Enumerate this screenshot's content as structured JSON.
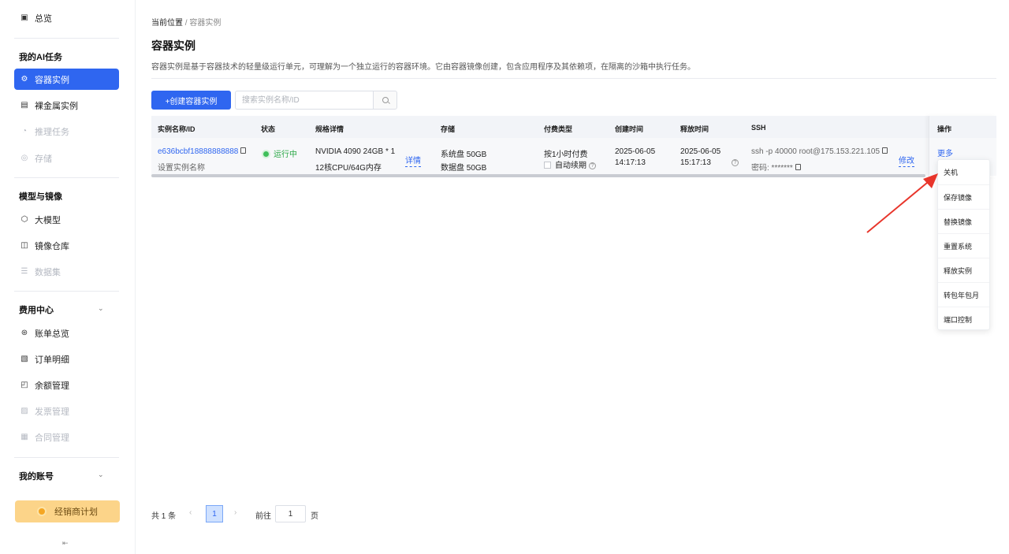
{
  "sidebar": {
    "overview": "总览",
    "group_ai": "我的AI任务",
    "ai_items": [
      {
        "label": "容器实例",
        "icon": "container-icon"
      },
      {
        "label": "裸金属实例",
        "icon": "server-icon"
      },
      {
        "label": "推理任务",
        "icon": "inference-icon"
      },
      {
        "label": "存储",
        "icon": "storage-icon"
      }
    ],
    "group_models": "模型与镜像",
    "model_items": [
      {
        "label": "大模型",
        "icon": "cube-icon"
      },
      {
        "label": "镜像仓库",
        "icon": "image-repo-icon"
      },
      {
        "label": "数据集",
        "icon": "dataset-icon"
      }
    ],
    "group_billing": "费用中心",
    "billing_items": [
      {
        "label": "账单总览",
        "icon": "bill-icon"
      },
      {
        "label": "订单明细",
        "icon": "order-icon"
      },
      {
        "label": "余额管理",
        "icon": "wallet-icon"
      },
      {
        "label": "发票管理",
        "icon": "invoice-icon"
      },
      {
        "label": "合同管理",
        "icon": "contract-icon"
      }
    ],
    "group_account": "我的账号",
    "reseller": "经销商计划",
    "collapse": "⇤"
  },
  "breadcrumb": {
    "prefix": "当前位置",
    "sep": "/",
    "current": "容器实例"
  },
  "page": {
    "title": "容器实例",
    "desc": "容器实例是基于容器技术的轻量级运行单元，可理解为一个独立运行的容器环境。它由容器镜像创建，包含应用程序及其依赖项，在隔离的沙箱中执行任务。"
  },
  "toolbar": {
    "create": "+创建容器实例",
    "search_placeholder": "搜索实例名称/ID"
  },
  "table": {
    "headers": {
      "name": "实例名称/ID",
      "status": "状态",
      "spec": "规格详情",
      "storage": "存储",
      "billing": "付费类型",
      "created": "创建时间",
      "release": "释放时间",
      "ssh": "SSH",
      "ops": "操作"
    },
    "row": {
      "id": "e636bcbf18888888888",
      "name_hint": "设置实例名称",
      "status": "运行中",
      "spec_line1": "NVIDIA 4090 24GB * 1",
      "spec_line2": "12核CPU/64G内存",
      "spec_detail": "详情",
      "storage_sys": "系统盘 50GB",
      "storage_data": "数据盘 50GB",
      "billing": "按1小时付费",
      "auto_renew": "自动续期",
      "created_date": "2025-06-05",
      "created_time": "14:17:13",
      "release_date": "2025-06-05",
      "release_time": "15:17:13",
      "ssh_cmd": "ssh -p 40000 root@175.153.221.105",
      "ssh_pwd": "密码: *******",
      "modify": "修改",
      "more": "更多"
    }
  },
  "menu": [
    "关机",
    "保存镜像",
    "替换镜像",
    "重置系统",
    "释放实例",
    "转包年包月",
    "端口控制"
  ],
  "pagination": {
    "total": "共 1 条",
    "page": "1",
    "goto": "前往",
    "goto_value": "1",
    "unit": "页"
  },
  "colors": {
    "primary": "#2f66f0",
    "running": "#3fbf5a",
    "annotation_arrow": "#e8352b"
  }
}
